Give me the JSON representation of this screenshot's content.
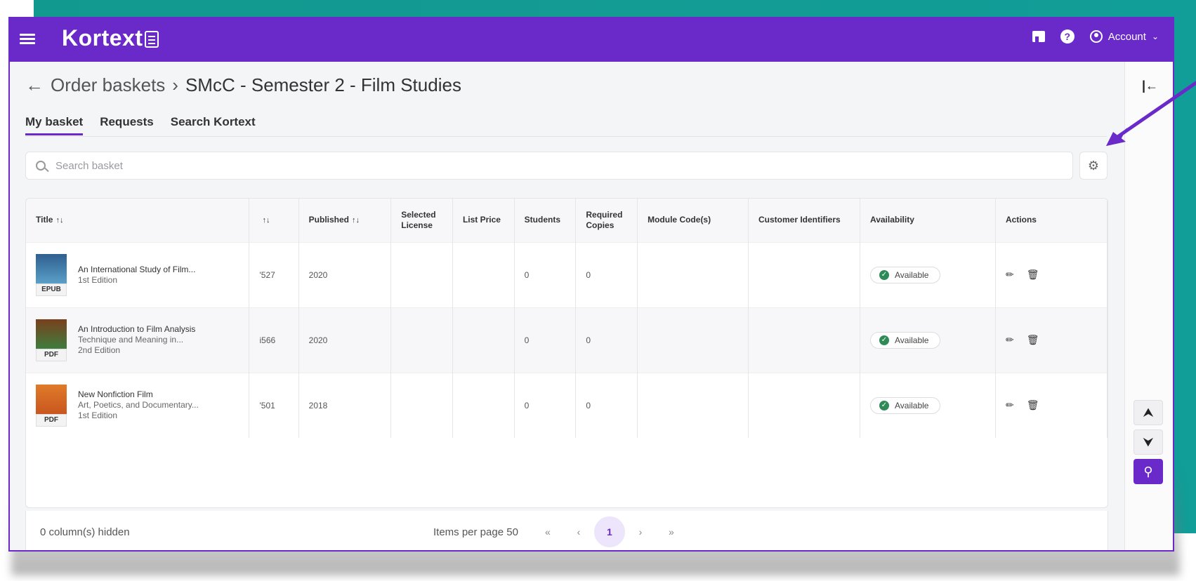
{
  "app": {
    "logo": "Kortext",
    "account_label": "Account"
  },
  "breadcrumb": {
    "parent": "Order baskets",
    "separator": "›",
    "current": "SMcC - Semester 2 - Film Studies"
  },
  "tabs": [
    {
      "label": "My basket",
      "active": true
    },
    {
      "label": "Requests",
      "active": false
    },
    {
      "label": "Search Kortext",
      "active": false
    }
  ],
  "search": {
    "placeholder": "Search basket"
  },
  "table": {
    "columns": [
      "Title",
      "",
      "Published",
      "Selected License",
      "List Price",
      "Students",
      "Required Copies",
      "Module Code(s)",
      "Customer Identifiers",
      "Availability",
      "Actions"
    ],
    "rows": [
      {
        "title": "An International Study of Film...",
        "subtitle": "",
        "edition": "1st Edition",
        "format": "EPUB",
        "isbn_tail": "'527",
        "published": "2020",
        "license": "",
        "price": "",
        "students": "0",
        "copies": "0",
        "module": "",
        "customer": "",
        "availability": "Available",
        "cover_color": "#2f5f8f"
      },
      {
        "title": "An Introduction to Film Analysis",
        "subtitle": "Technique and Meaning in...",
        "edition": "2nd Edition",
        "format": "PDF",
        "isbn_tail": "i566",
        "published": "2020",
        "license": "",
        "price": "",
        "students": "0",
        "copies": "0",
        "module": "",
        "customer": "",
        "availability": "Available",
        "cover_color": "#7a3f1c"
      },
      {
        "title": "New Nonfiction Film",
        "subtitle": "Art, Poetics, and Documentary...",
        "edition": "1st Edition",
        "format": "PDF",
        "isbn_tail": "'501",
        "published": "2018",
        "license": "",
        "price": "",
        "students": "0",
        "copies": "0",
        "module": "",
        "customer": "",
        "availability": "Available",
        "cover_color": "#e07b2a"
      }
    ]
  },
  "footer": {
    "hidden_columns": "0 column(s) hidden",
    "items_per_page": "Items per page 50",
    "first": "«",
    "prev": "‹",
    "current_page": "1",
    "next": "›",
    "last": "»"
  },
  "colors": {
    "brand": "#6a2ac9",
    "teal": "#12998f",
    "available": "#2e8b57"
  }
}
